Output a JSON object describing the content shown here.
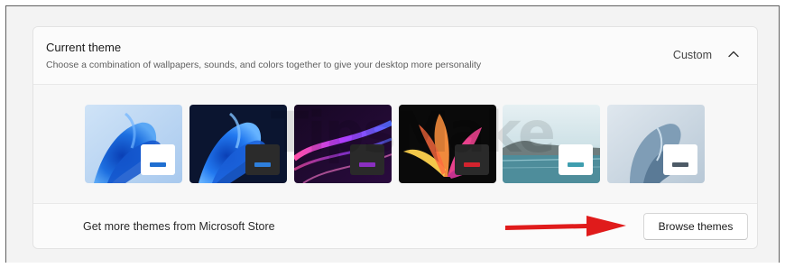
{
  "current_theme": {
    "title": "Current theme",
    "subtitle": "Choose a combination of wallpapers, sounds, and colors together to give your desktop more personality",
    "value": "Custom",
    "expand_icon": "chevron-up-icon"
  },
  "themes": [
    {
      "name": "windows-light-bloom",
      "accent": "#1f6fd1",
      "card": "#ffffff"
    },
    {
      "name": "windows-dark-bloom",
      "accent": "#2e7fdc",
      "card": "#2b2b2b"
    },
    {
      "name": "glow",
      "accent": "#8a2fc0",
      "card": "#2a2a2a"
    },
    {
      "name": "captured-motion",
      "accent": "#d2232e",
      "card": "#2a2a2a"
    },
    {
      "name": "sunrise",
      "accent": "#3f9eaf",
      "card": "#ffffff"
    },
    {
      "name": "flow",
      "accent": "#4d5a66",
      "card": "#ffffff"
    }
  ],
  "store": {
    "label": "Get more themes from Microsoft Store",
    "button_label": "Browse themes"
  },
  "annotation": {
    "arrow_color": "#e01b1b"
  },
  "watermark": {
    "text": "TipsMake"
  }
}
